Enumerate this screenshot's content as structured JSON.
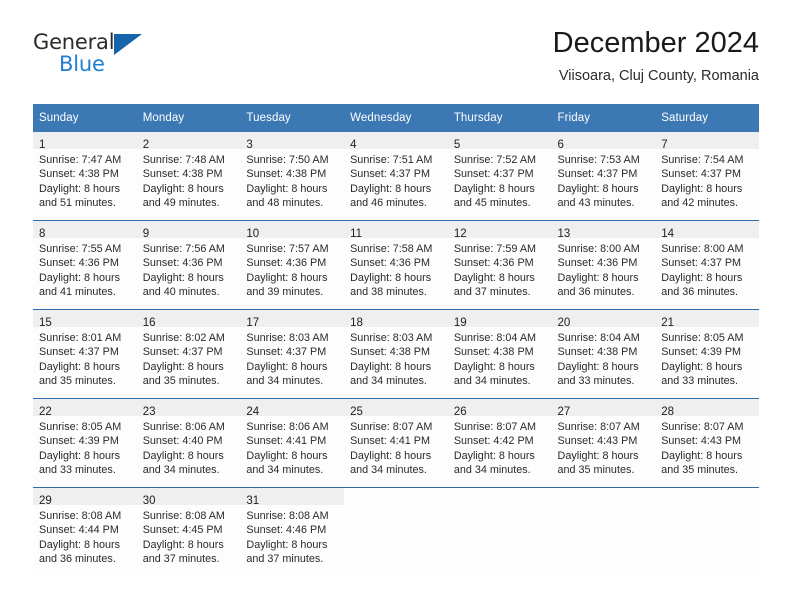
{
  "brand": {
    "word_one": "General",
    "word_two": "Blue",
    "triangle_icon": "triangle-icon"
  },
  "header": {
    "title": "December 2024",
    "subtitle": "Viisoara, Cluj County, Romania"
  },
  "colors": {
    "header_blue": "#3c78b4",
    "row_divider": "#2f6ca8",
    "daynum_bg": "#efefef",
    "brand_blue": "#1f7fd0",
    "brand_triangle": "#1665ab"
  },
  "calendar": {
    "weekday_headers": [
      "Sunday",
      "Monday",
      "Tuesday",
      "Wednesday",
      "Thursday",
      "Friday",
      "Saturday"
    ],
    "weeks": [
      [
        {
          "day": "1",
          "lines": [
            "Sunrise: 7:47 AM",
            "Sunset: 4:38 PM",
            "Daylight: 8 hours",
            "and 51 minutes."
          ]
        },
        {
          "day": "2",
          "lines": [
            "Sunrise: 7:48 AM",
            "Sunset: 4:38 PM",
            "Daylight: 8 hours",
            "and 49 minutes."
          ]
        },
        {
          "day": "3",
          "lines": [
            "Sunrise: 7:50 AM",
            "Sunset: 4:38 PM",
            "Daylight: 8 hours",
            "and 48 minutes."
          ]
        },
        {
          "day": "4",
          "lines": [
            "Sunrise: 7:51 AM",
            "Sunset: 4:37 PM",
            "Daylight: 8 hours",
            "and 46 minutes."
          ]
        },
        {
          "day": "5",
          "lines": [
            "Sunrise: 7:52 AM",
            "Sunset: 4:37 PM",
            "Daylight: 8 hours",
            "and 45 minutes."
          ]
        },
        {
          "day": "6",
          "lines": [
            "Sunrise: 7:53 AM",
            "Sunset: 4:37 PM",
            "Daylight: 8 hours",
            "and 43 minutes."
          ]
        },
        {
          "day": "7",
          "lines": [
            "Sunrise: 7:54 AM",
            "Sunset: 4:37 PM",
            "Daylight: 8 hours",
            "and 42 minutes."
          ]
        }
      ],
      [
        {
          "day": "8",
          "lines": [
            "Sunrise: 7:55 AM",
            "Sunset: 4:36 PM",
            "Daylight: 8 hours",
            "and 41 minutes."
          ]
        },
        {
          "day": "9",
          "lines": [
            "Sunrise: 7:56 AM",
            "Sunset: 4:36 PM",
            "Daylight: 8 hours",
            "and 40 minutes."
          ]
        },
        {
          "day": "10",
          "lines": [
            "Sunrise: 7:57 AM",
            "Sunset: 4:36 PM",
            "Daylight: 8 hours",
            "and 39 minutes."
          ]
        },
        {
          "day": "11",
          "lines": [
            "Sunrise: 7:58 AM",
            "Sunset: 4:36 PM",
            "Daylight: 8 hours",
            "and 38 minutes."
          ]
        },
        {
          "day": "12",
          "lines": [
            "Sunrise: 7:59 AM",
            "Sunset: 4:36 PM",
            "Daylight: 8 hours",
            "and 37 minutes."
          ]
        },
        {
          "day": "13",
          "lines": [
            "Sunrise: 8:00 AM",
            "Sunset: 4:36 PM",
            "Daylight: 8 hours",
            "and 36 minutes."
          ]
        },
        {
          "day": "14",
          "lines": [
            "Sunrise: 8:00 AM",
            "Sunset: 4:37 PM",
            "Daylight: 8 hours",
            "and 36 minutes."
          ]
        }
      ],
      [
        {
          "day": "15",
          "lines": [
            "Sunrise: 8:01 AM",
            "Sunset: 4:37 PM",
            "Daylight: 8 hours",
            "and 35 minutes."
          ]
        },
        {
          "day": "16",
          "lines": [
            "Sunrise: 8:02 AM",
            "Sunset: 4:37 PM",
            "Daylight: 8 hours",
            "and 35 minutes."
          ]
        },
        {
          "day": "17",
          "lines": [
            "Sunrise: 8:03 AM",
            "Sunset: 4:37 PM",
            "Daylight: 8 hours",
            "and 34 minutes."
          ]
        },
        {
          "day": "18",
          "lines": [
            "Sunrise: 8:03 AM",
            "Sunset: 4:38 PM",
            "Daylight: 8 hours",
            "and 34 minutes."
          ]
        },
        {
          "day": "19",
          "lines": [
            "Sunrise: 8:04 AM",
            "Sunset: 4:38 PM",
            "Daylight: 8 hours",
            "and 34 minutes."
          ]
        },
        {
          "day": "20",
          "lines": [
            "Sunrise: 8:04 AM",
            "Sunset: 4:38 PM",
            "Daylight: 8 hours",
            "and 33 minutes."
          ]
        },
        {
          "day": "21",
          "lines": [
            "Sunrise: 8:05 AM",
            "Sunset: 4:39 PM",
            "Daylight: 8 hours",
            "and 33 minutes."
          ]
        }
      ],
      [
        {
          "day": "22",
          "lines": [
            "Sunrise: 8:05 AM",
            "Sunset: 4:39 PM",
            "Daylight: 8 hours",
            "and 33 minutes."
          ]
        },
        {
          "day": "23",
          "lines": [
            "Sunrise: 8:06 AM",
            "Sunset: 4:40 PM",
            "Daylight: 8 hours",
            "and 34 minutes."
          ]
        },
        {
          "day": "24",
          "lines": [
            "Sunrise: 8:06 AM",
            "Sunset: 4:41 PM",
            "Daylight: 8 hours",
            "and 34 minutes."
          ]
        },
        {
          "day": "25",
          "lines": [
            "Sunrise: 8:07 AM",
            "Sunset: 4:41 PM",
            "Daylight: 8 hours",
            "and 34 minutes."
          ]
        },
        {
          "day": "26",
          "lines": [
            "Sunrise: 8:07 AM",
            "Sunset: 4:42 PM",
            "Daylight: 8 hours",
            "and 34 minutes."
          ]
        },
        {
          "day": "27",
          "lines": [
            "Sunrise: 8:07 AM",
            "Sunset: 4:43 PM",
            "Daylight: 8 hours",
            "and 35 minutes."
          ]
        },
        {
          "day": "28",
          "lines": [
            "Sunrise: 8:07 AM",
            "Sunset: 4:43 PM",
            "Daylight: 8 hours",
            "and 35 minutes."
          ]
        }
      ],
      [
        {
          "day": "29",
          "lines": [
            "Sunrise: 8:08 AM",
            "Sunset: 4:44 PM",
            "Daylight: 8 hours",
            "and 36 minutes."
          ]
        },
        {
          "day": "30",
          "lines": [
            "Sunrise: 8:08 AM",
            "Sunset: 4:45 PM",
            "Daylight: 8 hours",
            "and 37 minutes."
          ]
        },
        {
          "day": "31",
          "lines": [
            "Sunrise: 8:08 AM",
            "Sunset: 4:46 PM",
            "Daylight: 8 hours",
            "and 37 minutes."
          ]
        },
        {
          "day": "",
          "lines": []
        },
        {
          "day": "",
          "lines": []
        },
        {
          "day": "",
          "lines": []
        },
        {
          "day": "",
          "lines": []
        }
      ]
    ]
  }
}
